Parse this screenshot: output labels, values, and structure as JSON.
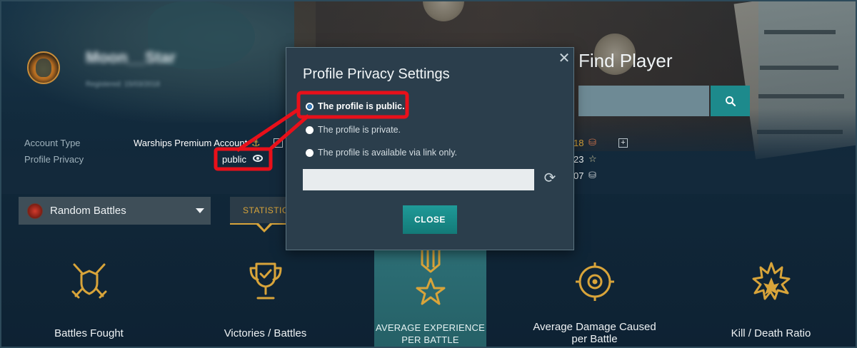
{
  "player": {
    "name": "Moon__Star",
    "registered": "Registered: 15/03/2018"
  },
  "account_info": {
    "account_type_label": "Account Type",
    "account_type_value": "Warships Premium Account",
    "privacy_label": "Profile Privacy",
    "privacy_value": "public"
  },
  "find_player": {
    "title": "Find Player",
    "placeholder": ""
  },
  "resources": [
    {
      "value": "18",
      "icon": "barrel-icon"
    },
    {
      "value": "23",
      "icon": "star-icon"
    },
    {
      "value": "07",
      "icon": "silver-icon"
    }
  ],
  "battle_select": {
    "label": "Random Battles",
    "icon": "random-battles-icon"
  },
  "tabs": {
    "statistics": "STATISTICS"
  },
  "stats": [
    {
      "label": "Battles Fought",
      "icon": "crossed-swords-shield-icon"
    },
    {
      "label": "Victories / Battles",
      "icon": "trophy-icon"
    },
    {
      "label": "AVERAGE EXPERIENCE PER BATTLE",
      "icon": "medal-icon"
    },
    {
      "label": "Average Damage Caused per Battle",
      "icon": "target-icon"
    },
    {
      "label": "Kill / Death Ratio",
      "icon": "explosion-icon"
    }
  ],
  "modal": {
    "title": "Profile Privacy Settings",
    "options": [
      "The profile is public.",
      "The profile is private.",
      "The profile is available via link only."
    ],
    "selected_index": 0,
    "link_value": "",
    "close_label": "CLOSE"
  },
  "colors": {
    "accent_gold": "#d8a43a",
    "teal": "#1d8a8c",
    "highlight_red": "#e8101a"
  }
}
